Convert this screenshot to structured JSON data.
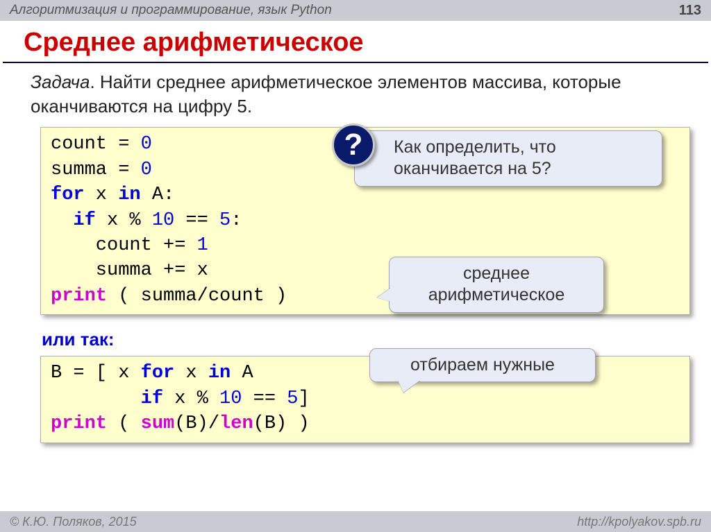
{
  "header": {
    "subject": "Алгоритмизация и программирование, язык Python",
    "page": "113"
  },
  "title": "Среднее арифметическое",
  "task": {
    "label": "Задача",
    "text": ". Найти среднее арифметическое элементов массива, которые оканчиваются на цифру 5."
  },
  "code1": {
    "l1a": "count",
    "l1b": " = ",
    "l1c": "0",
    "l2a": "summa",
    "l2b": " = ",
    "l2c": "0",
    "l3a": "for",
    "l3b": " x ",
    "l3c": "in",
    "l3d": " A:",
    "l4a": "  ",
    "l4b": "if",
    "l4c": " x % ",
    "l4d": "10",
    "l4e": " == ",
    "l4f": "5",
    "l4g": ":",
    "l5a": "    count += ",
    "l5b": "1",
    "l6a": "    summa += x",
    "l7a": "print",
    "l7b": " ( summa/count )"
  },
  "alt_label": "или так:",
  "code2": {
    "l1a": "B = [ x ",
    "l1b": "for",
    "l1c": " x ",
    "l1d": "in",
    "l1e": " A",
    "l2a": "        ",
    "l2b": "if",
    "l2c": " x % ",
    "l2d": "10",
    "l2e": " == ",
    "l2f": "5",
    "l2g": "]",
    "l3a": "print",
    "l3b": " ( ",
    "l3c": "sum",
    "l3d": "(B)/",
    "l3e": "len",
    "l3f": "(B) )"
  },
  "callouts": {
    "question_mark": "?",
    "question": "Как определить, что оканчивается на 5?",
    "average": "среднее арифметическое",
    "select": "отбираем нужные"
  },
  "footer": {
    "copyright": "© К.Ю. Поляков, 2015",
    "url": "http://kpolyakov.spb.ru"
  }
}
